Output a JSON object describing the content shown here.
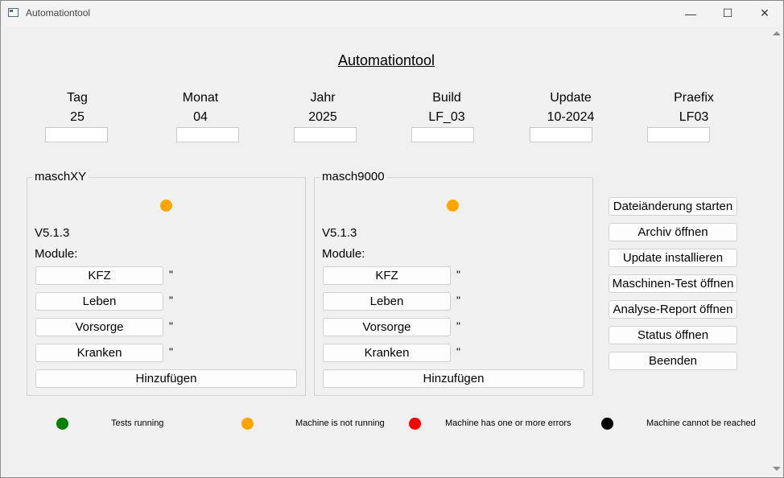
{
  "window": {
    "title": "Automationtool",
    "controls": {
      "minimize": "—",
      "maximize": "☐",
      "close": "✕"
    }
  },
  "heading": "Automationtool",
  "fields": [
    {
      "label": "Tag",
      "value": "25"
    },
    {
      "label": "Monat",
      "value": "04"
    },
    {
      "label": "Jahr",
      "value": "2025"
    },
    {
      "label": "Build",
      "value": "LF_03"
    },
    {
      "label": "Update",
      "value": "10-2024"
    },
    {
      "label": "Praefix",
      "value": "LF03"
    }
  ],
  "machines": [
    {
      "name": "maschXY",
      "status_color": "#ffa500",
      "version": "V5.1.3",
      "modules_label": "Module:",
      "modules": [
        "KFZ",
        "Leben",
        "Vorsorge",
        "Kranken"
      ],
      "module_mark": "\"",
      "add_label": "Hinzufügen"
    },
    {
      "name": "masch9000",
      "status_color": "#ffa500",
      "version": "V5.1.3",
      "modules_label": "Module:",
      "modules": [
        "KFZ",
        "Leben",
        "Vorsorge",
        "Kranken"
      ],
      "module_mark": "\"",
      "add_label": "Hinzufügen"
    }
  ],
  "actions": [
    "Dateiänderung starten",
    "Archiv öffnen",
    "Update installieren",
    "Maschinen-Test öffnen",
    "Analyse-Report öffnen",
    "Status öffnen",
    "Beenden"
  ],
  "legend": [
    {
      "color": "#008000",
      "text": "Tests running"
    },
    {
      "color": "#ffa500",
      "text": "Machine is not running"
    },
    {
      "color": "#ff0000",
      "text": "Machine has one or more errors"
    },
    {
      "color": "#000000",
      "text": "Machine cannot be reached"
    }
  ]
}
